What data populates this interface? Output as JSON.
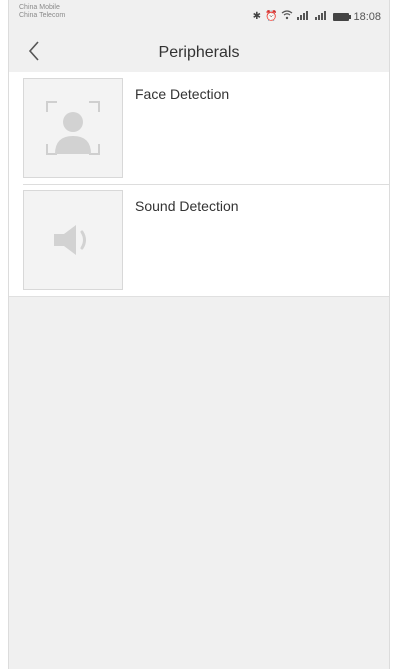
{
  "status_bar": {
    "carrier_1": "China Mobile",
    "carrier_2": "China Telecom",
    "time": "18:08"
  },
  "nav": {
    "back_icon": "chevron-left-icon",
    "title": "Peripherals"
  },
  "items": [
    {
      "label": "Face Detection",
      "icon": "face-detection-icon"
    },
    {
      "label": "Sound Detection",
      "icon": "speaker-icon"
    }
  ]
}
